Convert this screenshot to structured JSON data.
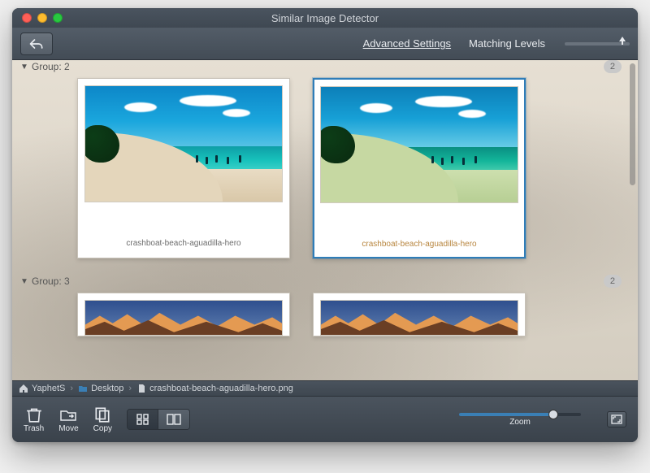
{
  "window": {
    "title": "Similar Image Detector"
  },
  "toolbar": {
    "advanced_settings": "Advanced Settings",
    "matching_levels": "Matching Levels"
  },
  "groups": [
    {
      "label": "Group: 2",
      "badge": "2",
      "collapsed": false,
      "items": [
        {
          "caption": "crashboat-beach-aguadilla-hero",
          "selected": false
        },
        {
          "caption": "crashboat-beach-aguadilla-hero",
          "selected": true
        }
      ]
    },
    {
      "label": "Group: 3",
      "badge": "2",
      "collapsed": false,
      "items": [
        {
          "caption": "",
          "selected": false
        },
        {
          "caption": "",
          "selected": false
        }
      ]
    }
  ],
  "path": {
    "segments": [
      "YaphetS",
      "Desktop",
      "crashboat-beach-aguadilla-hero.png"
    ]
  },
  "bottombar": {
    "trash": "Trash",
    "move": "Move",
    "copy": "Copy",
    "zoom": "Zoom"
  },
  "icons": {
    "back": "back-arrow-icon",
    "home": "home-icon",
    "folder": "folder-icon",
    "file": "file-icon"
  },
  "colors": {
    "accent": "#2f7db8",
    "selected_text": "#b8863f"
  }
}
